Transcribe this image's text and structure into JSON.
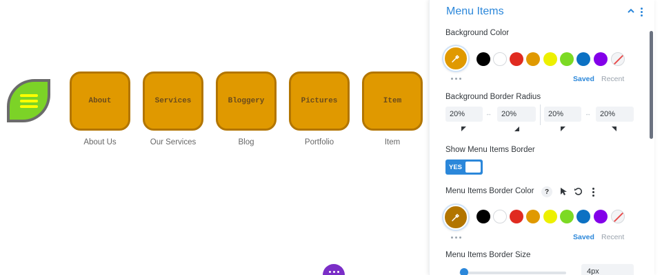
{
  "canvas": {
    "menu_items": [
      {
        "label": "About",
        "sublabel": "About Us"
      },
      {
        "label": "Services",
        "sublabel": "Our Services"
      },
      {
        "label": "Bloggery",
        "sublabel": "Blog"
      },
      {
        "label": "Pictures",
        "sublabel": "Portfolio"
      },
      {
        "label": "Item",
        "sublabel": "Item"
      }
    ],
    "hamburger_icon": "hamburger-menu-icon",
    "fab_icon": "ellipsis-icon"
  },
  "panel": {
    "title": "Menu Items",
    "collapse_icon": "chevron-up-icon",
    "menu_icon": "kebab-menu-icon",
    "background_color": {
      "label": "Background Color",
      "current": "#e09900",
      "swatches": [
        "#000000",
        "#ffffff",
        "#e02b20",
        "#e09900",
        "#edf000",
        "#7cda24",
        "#0c71c3",
        "#8300e9",
        "none"
      ],
      "tabs": {
        "saved": "Saved",
        "recent": "Recent"
      }
    },
    "border_radius": {
      "label": "Background Border Radius",
      "values": [
        "20%",
        "20%",
        "20%",
        "20%"
      ]
    },
    "show_border": {
      "label": "Show Menu Items Border",
      "toggle": "YES",
      "enabled": true
    },
    "border_color": {
      "label": "Menu Items Border Color",
      "current": "#b27500",
      "tools": {
        "help": "?",
        "cursor": "cursor-icon",
        "reset": "reset-icon",
        "more": "kebab-menu-icon"
      },
      "swatches": [
        "#000000",
        "#ffffff",
        "#e02b20",
        "#e09900",
        "#edf000",
        "#7cda24",
        "#0c71c3",
        "#8300e9",
        "none"
      ],
      "tabs": {
        "saved": "Saved",
        "recent": "Recent"
      }
    },
    "border_size": {
      "label": "Menu Items Border Size",
      "value": "4px",
      "slider_fraction": 0.05
    }
  },
  "colors": {
    "accent": "#2b87da",
    "menu_item_fill": "#e09900",
    "menu_item_border": "#b27500",
    "hamburger_fill": "#7cd327",
    "fab": "#7b2ec7"
  }
}
